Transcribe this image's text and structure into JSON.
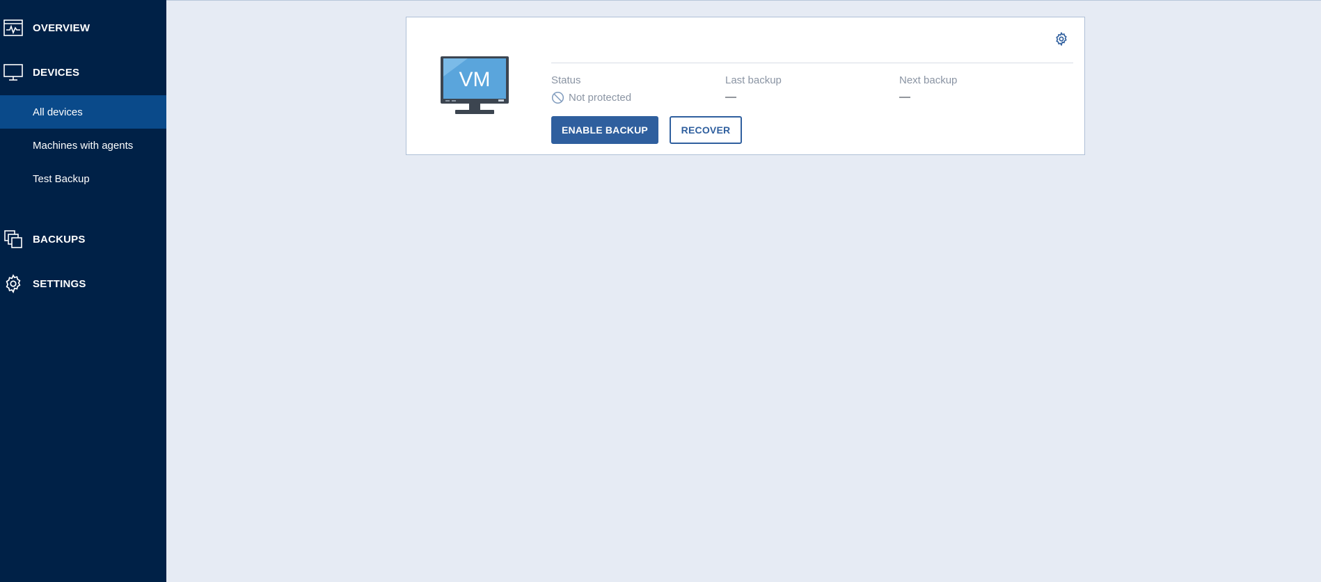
{
  "sidebar": {
    "sections": {
      "overview": {
        "label": "OVERVIEW",
        "icon": "activity-monitor-icon"
      },
      "devices": {
        "label": "DEVICES",
        "icon": "monitor-icon"
      },
      "backups": {
        "label": "BACKUPS",
        "icon": "stacked-squares-icon"
      },
      "settings": {
        "label": "SETTINGS",
        "icon": "gear-icon"
      }
    },
    "devices_items": [
      {
        "label": "All devices",
        "active": true
      },
      {
        "label": "Machines with agents",
        "active": false
      },
      {
        "label": "Test Backup",
        "active": false
      }
    ]
  },
  "card": {
    "device_icon_text": "VM",
    "status_label": "Status",
    "status_value": "Not protected",
    "last_backup_label": "Last backup",
    "last_backup_value": "—",
    "next_backup_label": "Next backup",
    "next_backup_value": "—",
    "enable_backup_label": "ENABLE BACKUP",
    "recover_label": "RECOVER"
  },
  "colors": {
    "sidebar_bg": "#002147",
    "sidebar_active": "#0a4a8a",
    "page_bg": "#e6ebf4",
    "accent": "#2f5f9e"
  }
}
